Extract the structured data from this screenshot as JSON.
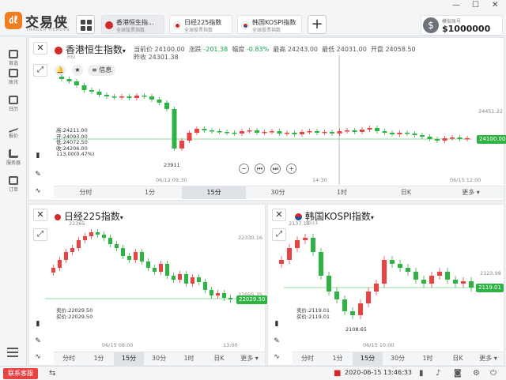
{
  "app": {
    "logo_text": "交易侠",
    "logo_sub": "TRADER HEROES",
    "window_controls": {
      "minimize": "—",
      "maximize": "☐",
      "close": "✕"
    },
    "add_label": "+"
  },
  "market_tabs": [
    {
      "title": "香港恒生指...",
      "subtitle": "全球股票指数",
      "color": "#d62828"
    },
    {
      "title": "日经225指数",
      "subtitle": "全球股票指数",
      "color": "#d62828"
    },
    {
      "title": "韩国KOSPI指数",
      "subtitle": "全球股票指数",
      "color": "#1f4fa3"
    }
  ],
  "account": {
    "label": "模拟账号",
    "amount": "$1000000",
    "coin": "$"
  },
  "sidebar": [
    {
      "label": "首选"
    },
    {
      "label": "账讯"
    },
    {
      "label": "日历"
    },
    {
      "label": "报价"
    },
    {
      "label": "服务器"
    },
    {
      "label": "订单"
    }
  ],
  "hsi": {
    "title": "香港恒生指数",
    "code": "HSI",
    "quote": {
      "current_label": "当前价",
      "current": "24100.00",
      "change_label": "涨跌",
      "change": "-201.38",
      "pct_label": "幅度",
      "pct": "-0.83%",
      "high_label": "最高",
      "high": "24243.00",
      "low_label": "最低",
      "low": "24031.00",
      "open_label": "开盘",
      "open": "24058.50",
      "prev_label": "昨收",
      "prev": "24301.38"
    },
    "info_label": "信息",
    "ohlc": [
      "高:24211.00",
      "开:24093.00",
      "低:24072.50",
      "收:24206.00",
      "113.00(0.47%)"
    ],
    "low_marker": "23911",
    "right_axis": "24451.22",
    "price_tag": "24100.00",
    "times": [
      "06/12 09:30",
      "14:30",
      "06/15 12:00"
    ],
    "tabs": [
      "分时",
      "1分",
      "15分",
      "30分",
      "1时",
      "日K",
      "更多"
    ],
    "active_tab": 2,
    "chart_data": {
      "type": "candlestick",
      "series": [
        {
          "values": []
        }
      ]
    }
  },
  "nikkei": {
    "title": "日经225指数",
    "top_label": "22365",
    "right_axis_top": "22330.16",
    "right_axis_mid": "22055.35",
    "price_tag": "22029.50",
    "sell": "卖价:22029.50",
    "buy": "买价:22029.50",
    "times": [
      "06/15 08:00",
      "13:00"
    ],
    "tabs": [
      "分时",
      "1分",
      "15分",
      "30分",
      "1时",
      "日K",
      "更多"
    ],
    "active_tab": 2
  },
  "kospi": {
    "title": "韩国KOSPI指数",
    "code": "KS11",
    "top_label": "2137.12",
    "right_axis": "2123.98",
    "price_tag": "2119.01",
    "sell": "卖价:2119.01",
    "buy": "买价:2119.01",
    "low_marker": "2108.65",
    "times": [
      "06/15 10:00"
    ],
    "tabs": [
      "分时",
      "1分",
      "15分",
      "30分",
      "1时",
      "日K",
      "更多"
    ],
    "active_tab": 2
  },
  "status": {
    "support": "联系客服",
    "datetime": "2020-06-15 13:46:33"
  },
  "colors": {
    "up": "#e84242",
    "down": "#2fb344",
    "accent": "#f07d1e"
  }
}
